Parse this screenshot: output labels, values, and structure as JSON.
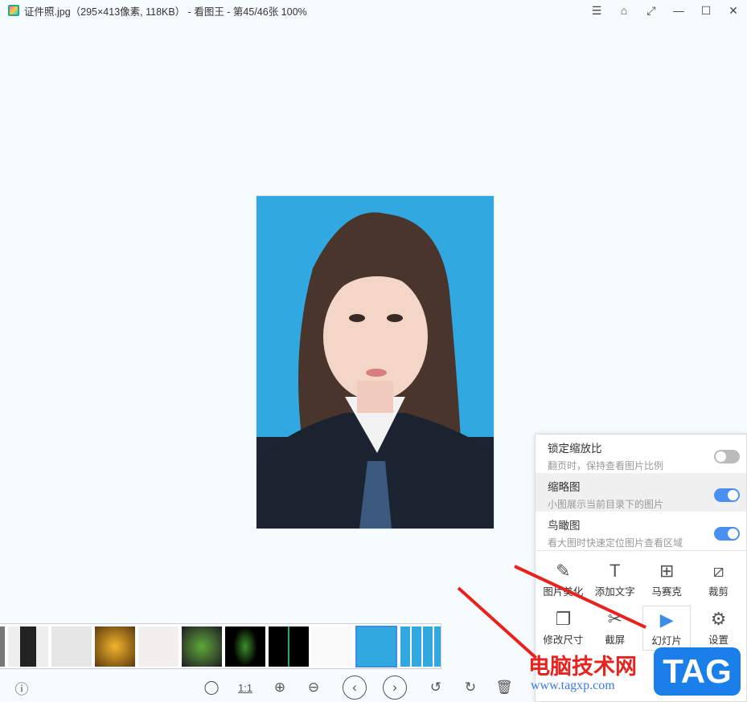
{
  "window": {
    "title": "证件照.jpg（295×413像素, 118KB） - 看图王 - 第45/46张 100%",
    "controls": [
      "☰",
      "⌂",
      "⤢",
      "—",
      "☐",
      "✕"
    ]
  },
  "toolbar": {
    "actual_size": "1:1"
  },
  "popup": {
    "options": [
      {
        "title": "锁定缩放比",
        "subtitle": "翻页时，保持查看图片比例",
        "enabled": false
      },
      {
        "title": "缩略图",
        "subtitle": "小图展示当前目录下的图片",
        "enabled": true
      },
      {
        "title": "鸟瞰图",
        "subtitle": "看大图时快速定位图片查看区域",
        "enabled": true
      }
    ],
    "tools": [
      {
        "label": "图片美化",
        "icon": "✎"
      },
      {
        "label": "添加文字",
        "icon": "T"
      },
      {
        "label": "马赛克",
        "icon": "⊞"
      },
      {
        "label": "裁剪",
        "icon": "⧄"
      },
      {
        "label": "修改尺寸",
        "icon": "❐"
      },
      {
        "label": "截屏",
        "icon": "✂"
      },
      {
        "label": "幻灯片",
        "icon": "▶"
      },
      {
        "label": "设置",
        "icon": "⚙"
      }
    ]
  },
  "watermark": {
    "site_name": "电脑技术网",
    "url": "www.tagxp.com",
    "logo": "TAG"
  }
}
